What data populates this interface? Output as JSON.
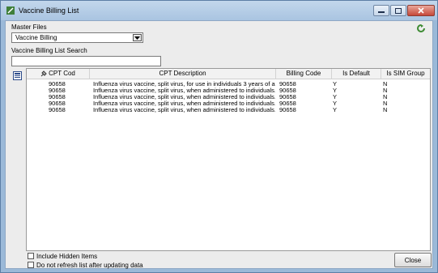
{
  "window": {
    "title": "Vaccine Billing List"
  },
  "master_files": {
    "label": "Master Files",
    "selected": "Vaccine Billing"
  },
  "search": {
    "label": "Vaccine Billing List Search",
    "value": ""
  },
  "grid": {
    "columns": [
      "CPT Cod",
      "CPT Description",
      "Billing Code",
      "Is Default",
      "Is SIM Group"
    ],
    "rows": [
      {
        "cpt": "90658",
        "desc": "Influenza virus vaccine, split virus, for use in individuals 3 years of a...",
        "billing": "90658",
        "default": "Y",
        "sim": "N"
      },
      {
        "cpt": "90658",
        "desc": "Influenza virus vaccine, split virus, when administered to individuals...",
        "billing": "90658",
        "default": "Y",
        "sim": "N"
      },
      {
        "cpt": "90658",
        "desc": "Influenza virus vaccine, split virus, when administered to individuals...",
        "billing": "90658",
        "default": "Y",
        "sim": "N"
      },
      {
        "cpt": "90658",
        "desc": "Influenza virus vaccine, split virus, when administered to individuals...",
        "billing": "90658",
        "default": "Y",
        "sim": "N"
      },
      {
        "cpt": "90658",
        "desc": "Influenza virus vaccine, split virus, when administered to individuals...",
        "billing": "90658",
        "default": "Y",
        "sim": "N"
      }
    ]
  },
  "options": {
    "include_hidden": "Include Hidden Items",
    "no_refresh": "Do not refresh list after updating data"
  },
  "buttons": {
    "close": "Close"
  },
  "icons": {
    "title": "syringe-icon",
    "refresh": "refresh-icon",
    "grid_menu": "grid-menu-icon",
    "pin": "pin-icon"
  },
  "colors": {
    "titlebar": "#a9c4e1",
    "client": "#ececec",
    "close_red": "#c6483a"
  }
}
